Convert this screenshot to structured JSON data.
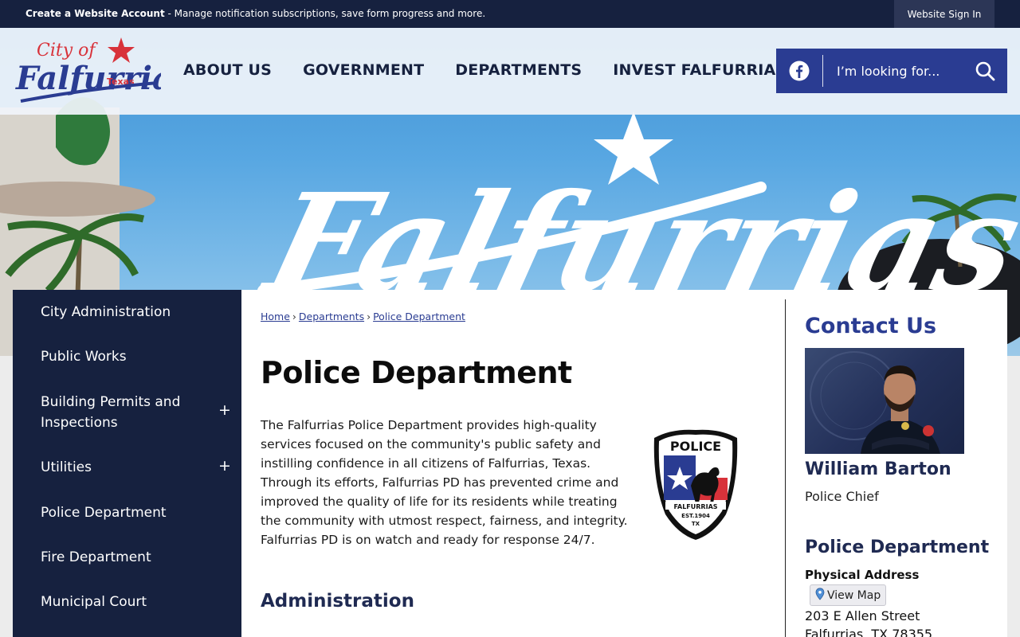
{
  "topbar": {
    "create_account": "Create a Website Account",
    "message": " - Manage notification subscriptions, save form progress and more.",
    "signin": "Website Sign In"
  },
  "logo": {
    "line1": "City of",
    "line2": "Falfurrias",
    "line3": "Texas"
  },
  "hero": {
    "script_text": "Falfurrias"
  },
  "nav": [
    "ABOUT US",
    "GOVERNMENT",
    "DEPARTMENTS",
    "INVEST FALFURRIAS"
  ],
  "search": {
    "placeholder": "I’m looking for..."
  },
  "sidebar": {
    "items": [
      {
        "label": "City Administration",
        "expandable": false
      },
      {
        "label": "Public Works",
        "expandable": false
      },
      {
        "label": "Building Permits and Inspections",
        "expandable": true
      },
      {
        "label": "Utilities",
        "expandable": true
      },
      {
        "label": "Police Department",
        "expandable": false
      },
      {
        "label": "Fire Department",
        "expandable": false
      },
      {
        "label": "Municipal Court",
        "expandable": false
      }
    ],
    "expand_glyph": "+"
  },
  "breadcrumb": {
    "items": [
      "Home",
      "Departments",
      "Police Department"
    ],
    "separator": "›"
  },
  "main": {
    "title": "Police Department",
    "intro": "The Falfurrias Police Department provides high-quality services focused on the community's public safety and instilling confidence in all citizens of Falfurrias, Texas. Through its efforts, Falfurrias PD has prevented crime and improved the quality of life for its residents while treating the community with utmost respect, fairness, and integrity. Falfurrias PD is on watch and ready for response 24/7.",
    "section_heading": "Administration"
  },
  "badge": {
    "top": "POLICE",
    "name": "FALFURRIAS",
    "est": "EST.1904",
    "state": "TX"
  },
  "contact": {
    "title": "Contact Us",
    "name": "William Barton",
    "role": "Police Chief",
    "dept": "Police Department",
    "address_label": "Physical Address",
    "view_map": "View Map",
    "address_line1": "203 E Allen Street",
    "address_line2": "Falfurrias, TX 78355"
  },
  "colors": {
    "navy": "#16213f",
    "accent": "#2a3c92",
    "red": "#d8323a"
  }
}
